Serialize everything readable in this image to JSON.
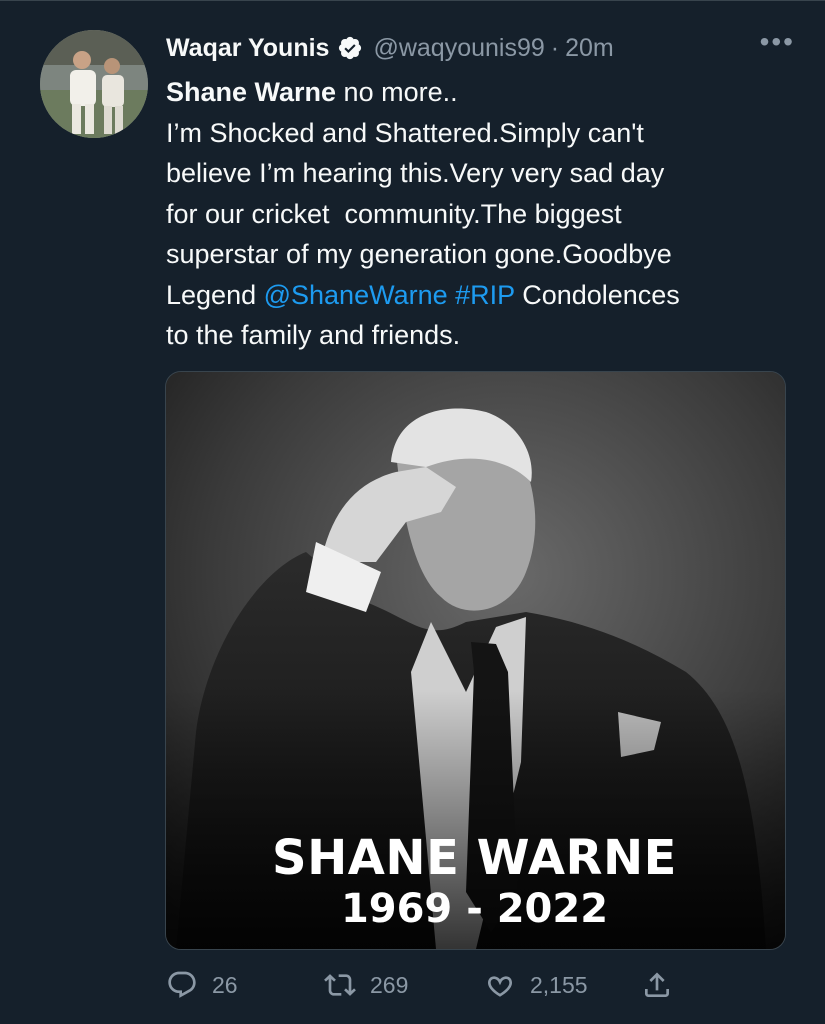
{
  "tweet": {
    "author_name": "Waqar Younis",
    "handle": "@waqyounis99",
    "separator": "·",
    "time": "20m",
    "more_label": "•••",
    "text": {
      "line1_bold": "Shane Warne",
      "line1_rest": " no more..",
      "line2": "I’m Shocked and Shattered.Simply can't",
      "line3": "believe I’m hearing this.Very very sad day",
      "line4": "for our cricket  community.The biggest",
      "line5": "superstar of my generation gone.Goodbye",
      "line6_pre": "Legend ",
      "mention": "@ShaneWarne",
      "line6_mid": " ",
      "hashtag": "#RIP",
      "line6_post": " Condolences",
      "line7": "to the family and friends."
    },
    "media": {
      "title": "SHANE WARNE",
      "years": "1969 - 2022"
    },
    "actions": {
      "replies": "26",
      "retweets": "269",
      "likes": "2,155"
    }
  },
  "colors": {
    "background": "#15202b",
    "link": "#1d9bf0",
    "muted": "#8b98a5",
    "verified": "#1d9bf0"
  },
  "icons": [
    "verified-icon",
    "more-icon",
    "reply-icon",
    "retweet-icon",
    "like-icon",
    "share-icon"
  ]
}
